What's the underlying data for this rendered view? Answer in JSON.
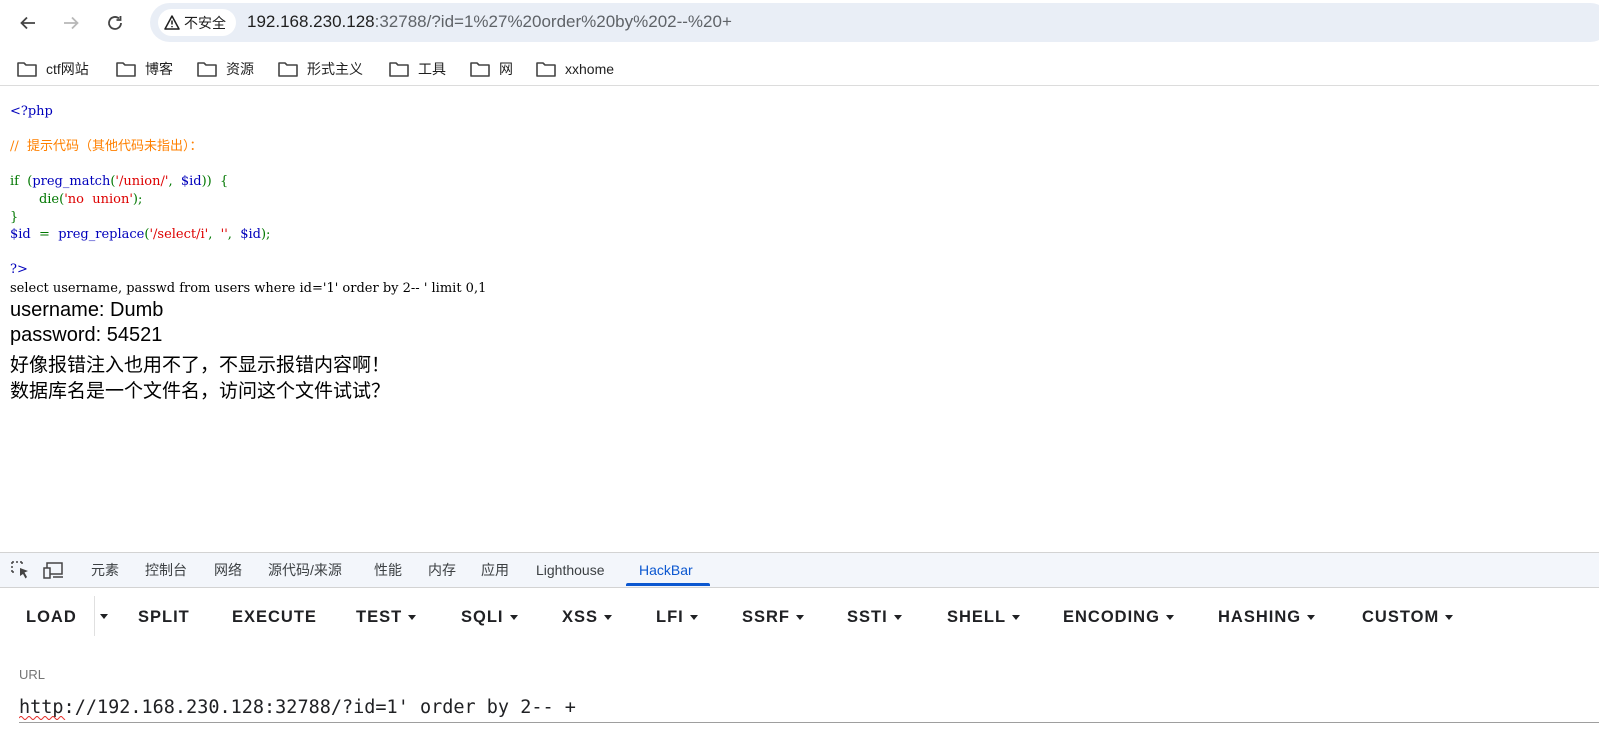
{
  "browser": {
    "security_label": "不安全",
    "url_host": "192.168.230.128",
    "url_rest": ":32788/?id=1%27%20order%20by%202--%20+"
  },
  "bookmarks": [
    "ctf网站",
    "博客",
    "资源",
    "形式主义",
    "工具",
    "网",
    "xxhome"
  ],
  "code": {
    "open_tag": "<?php",
    "comment": "//  提示代码（其他代码未指出）：",
    "if_kw": "if",
    "paren_open": "  (",
    "fn_match": "preg_match",
    "p1": "(",
    "str_union": "'/union/'",
    "comma1": ",  ",
    "var_id": "$id",
    "close_brace_open": "))  {",
    "indent": "       ",
    "die_fn": "die(",
    "str_no_union": "'no  union'",
    "die_close": ");",
    "brace_close": "}",
    "assign_var": "$id",
    "assign_eq": "  =  ",
    "fn_replace": "preg_replace",
    "p2": "(",
    "str_select": "'/select/i'",
    "comma2": ",  ",
    "str_empty": "''",
    "comma3": ",  ",
    "var_id2": "$id",
    "end_call": ");",
    "close_tag": "?>"
  },
  "output": {
    "sql": "select username, passwd from users where id='1' order by 2-- ' limit 0,1",
    "username": "username: Dumb",
    "password": "password: 54521",
    "msg1": "好像报错注入也用不了，不显示报错内容啊！",
    "msg2": "数据库名是一个文件名，访问这个文件试试？"
  },
  "devtools": {
    "tabs": [
      "元素",
      "控制台",
      "网络",
      "源代码/来源",
      "性能",
      "内存",
      "应用",
      "Lighthouse",
      "HackBar"
    ],
    "active_tab": "HackBar"
  },
  "hackbar": {
    "buttons": [
      "LOAD",
      "SPLIT",
      "EXECUTE",
      "TEST",
      "SQLI",
      "XSS",
      "LFI",
      "SSRF",
      "SSTI",
      "SHELL",
      "ENCODING",
      "HASHING",
      "CUSTOM"
    ],
    "url_label": "URL",
    "url_value": "http://192.168.230.128:32788/?id=1' order by 2-- +"
  },
  "colors": {
    "accent": "#0b57d0",
    "php_keyword": "#007700",
    "php_string": "#dd0000",
    "php_comment": "#ff8000",
    "php_default": "#0000bb"
  }
}
